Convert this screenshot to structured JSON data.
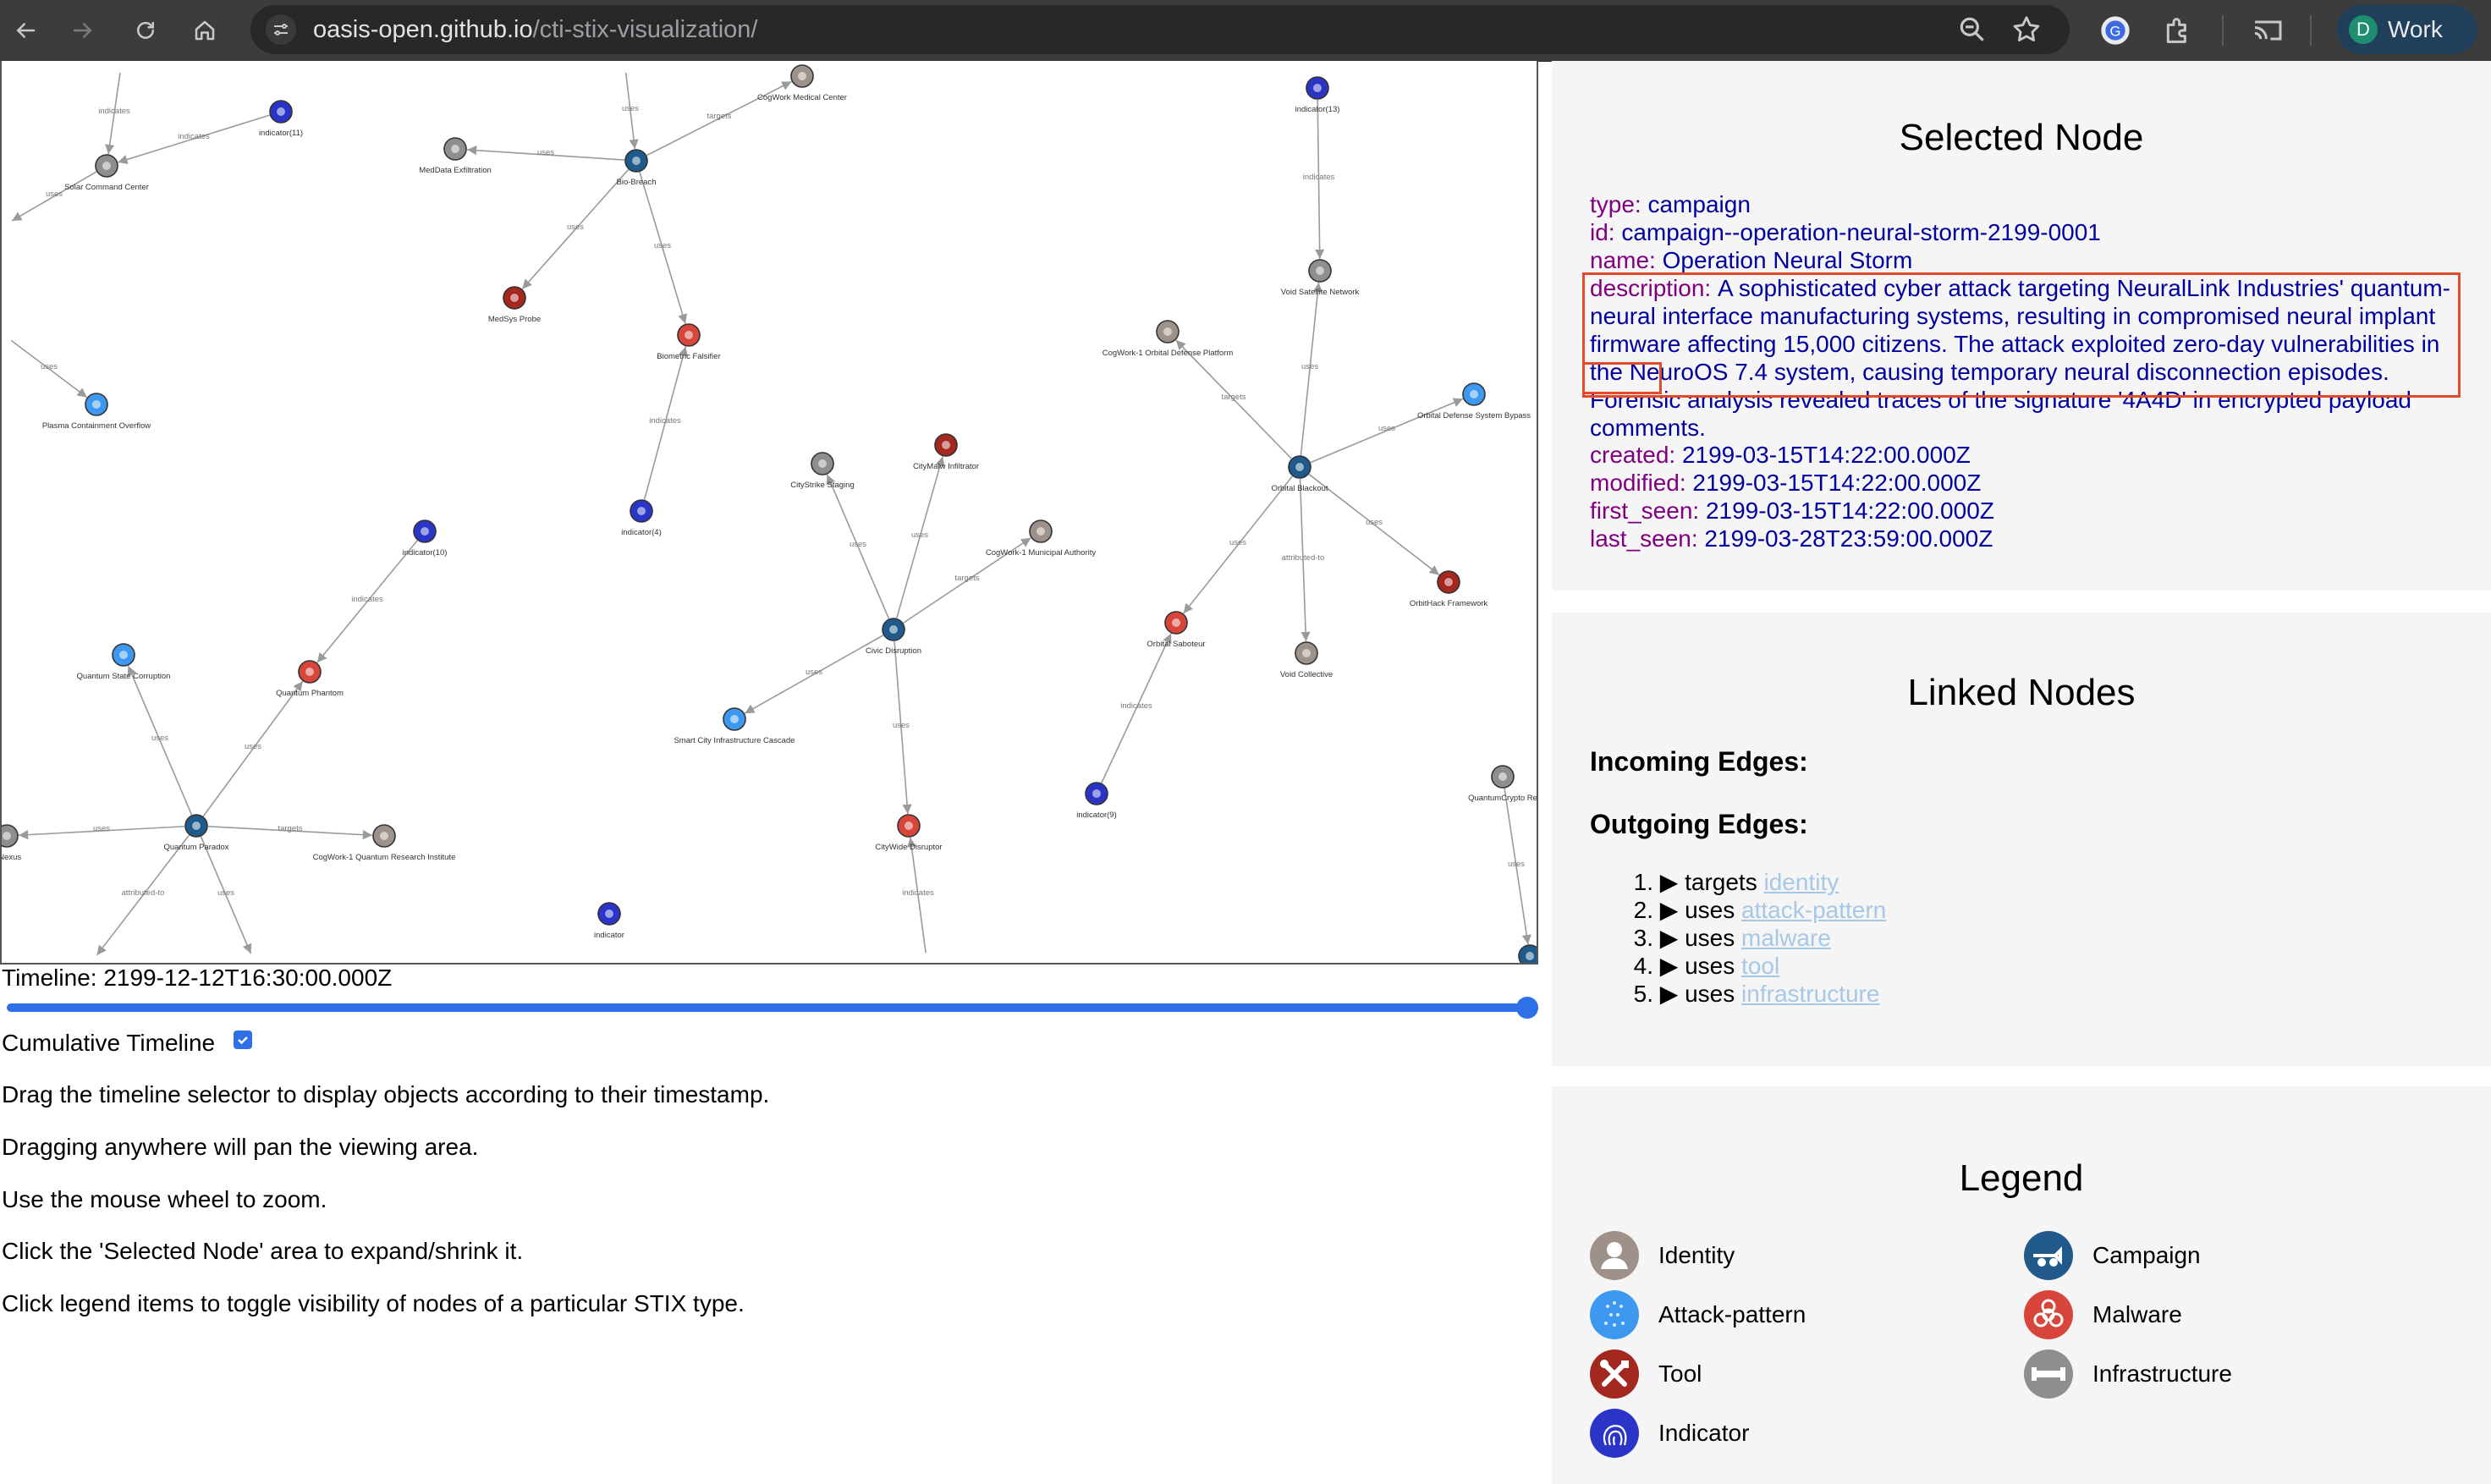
{
  "browser": {
    "url_host": "oasis-open.github.io",
    "url_path": "/cti-stix-visualization/",
    "profile_initial": "D",
    "profile_label": "Work"
  },
  "graph": {
    "edges": [
      {
        "from": "t_indicates_top",
        "to": "solar",
        "label": "indicates"
      },
      {
        "from": "ind11",
        "to": "solar",
        "label": "indicates"
      },
      {
        "from": "solar",
        "to": "t_left_uses",
        "label": "uses"
      },
      {
        "from": "t_left_uses2",
        "to": "plasma",
        "label": "uses"
      },
      {
        "from": "t_top_uses",
        "to": "biobreach",
        "label": "uses"
      },
      {
        "from": "biobreach",
        "to": "cogmed",
        "label": "targets"
      },
      {
        "from": "biobreach",
        "to": "medexf",
        "label": "uses"
      },
      {
        "from": "biobreach",
        "to": "medsys",
        "label": "uses"
      },
      {
        "from": "biobreach",
        "to": "biomet",
        "label": "uses"
      },
      {
        "from": "ind4",
        "to": "biomet",
        "label": "indicates"
      },
      {
        "from": "ind13",
        "to": "voidsat",
        "label": "indicates"
      },
      {
        "from": "orbital",
        "to": "voidsat",
        "label": "uses"
      },
      {
        "from": "orbital",
        "to": "cogorb",
        "label": "targets"
      },
      {
        "from": "orbital",
        "to": "orbdef",
        "label": "uses"
      },
      {
        "from": "orbital",
        "to": "orbhack",
        "label": "uses"
      },
      {
        "from": "orbital",
        "to": "orbsab",
        "label": "uses"
      },
      {
        "from": "orbital",
        "to": "voidcol",
        "label": "attributed-to"
      },
      {
        "from": "ind9",
        "to": "orbsab",
        "label": "indicates"
      },
      {
        "from": "civic",
        "to": "citystrike",
        "label": "uses"
      },
      {
        "from": "civic",
        "to": "citymalw",
        "label": "uses"
      },
      {
        "from": "civic",
        "to": "cogmun",
        "label": "targets"
      },
      {
        "from": "civic",
        "to": "smartcity",
        "label": "uses"
      },
      {
        "from": "civic",
        "to": "citywide",
        "label": "uses"
      },
      {
        "from": "t_bottom_ind",
        "to": "citywide",
        "label": "indicates"
      },
      {
        "from": "ind10",
        "to": "qphantom",
        "label": "indicates"
      },
      {
        "from": "qparadox",
        "to": "qstate",
        "label": "uses"
      },
      {
        "from": "qparadox",
        "to": "qphantom",
        "label": "uses"
      },
      {
        "from": "qparadox",
        "to": "cogqri",
        "label": "targets"
      },
      {
        "from": "qparadox",
        "to": "nexus",
        "label": "uses"
      },
      {
        "from": "qparadox",
        "to": "t_attr",
        "label": "attributed-to"
      },
      {
        "from": "qparadox",
        "to": "t_uses_b",
        "label": "uses"
      },
      {
        "from": "qcrypto",
        "to": "campaign_br",
        "label": "uses"
      }
    ],
    "nodes": [
      {
        "id": "solar",
        "label": "Solar Command Center",
        "type": "infrastructure"
      },
      {
        "id": "ind11",
        "label": "indicator(11)",
        "type": "indicator"
      },
      {
        "id": "plasma",
        "label": "Plasma Containment Overflow",
        "type": "attack-pattern"
      },
      {
        "id": "cogmed",
        "label": "CogWork Medical Center",
        "type": "identity"
      },
      {
        "id": "medexf",
        "label": "MedData Exfiltration",
        "type": "infrastructure"
      },
      {
        "id": "biobreach",
        "label": "Bio-Breach",
        "type": "campaign"
      },
      {
        "id": "medsys",
        "label": "MedSys Probe",
        "type": "tool"
      },
      {
        "id": "biomet",
        "label": "Biometric Falsifier",
        "type": "malware"
      },
      {
        "id": "ind4",
        "label": "indicator(4)",
        "type": "indicator"
      },
      {
        "id": "ind13",
        "label": "indicator(13)",
        "type": "indicator"
      },
      {
        "id": "voidsat",
        "label": "Void Satellite Network",
        "type": "infrastructure"
      },
      {
        "id": "cogorb",
        "label": "CogWork-1 Orbital Defense Platform",
        "type": "identity"
      },
      {
        "id": "orbdef",
        "label": "Orbital Defense System Bypass",
        "type": "attack-pattern"
      },
      {
        "id": "orbital",
        "label": "Orbital Blackout",
        "type": "campaign"
      },
      {
        "id": "orbhack",
        "label": "OrbitHack Framework",
        "type": "tool"
      },
      {
        "id": "orbsab",
        "label": "Orbital Saboteur",
        "type": "malware"
      },
      {
        "id": "voidcol",
        "label": "Void Collective",
        "type": "identity"
      },
      {
        "id": "ind9",
        "label": "indicator(9)",
        "type": "indicator"
      },
      {
        "id": "citystrike",
        "label": "CityStrike Staging",
        "type": "infrastructure"
      },
      {
        "id": "citymalw",
        "label": "CityMalw Infiltrator",
        "type": "tool"
      },
      {
        "id": "cogmun",
        "label": "CogWork-1 Municipal Authority",
        "type": "identity"
      },
      {
        "id": "civic",
        "label": "Civic Disruption",
        "type": "campaign"
      },
      {
        "id": "smartcity",
        "label": "Smart City Infrastructure Cascade",
        "type": "attack-pattern"
      },
      {
        "id": "citywide",
        "label": "CityWide Disruptor",
        "type": "malware"
      },
      {
        "id": "ind10",
        "label": "indicator(10)",
        "type": "indicator"
      },
      {
        "id": "qstate",
        "label": "Quantum State Corruption",
        "type": "attack-pattern"
      },
      {
        "id": "qphantom",
        "label": "Quantum Phantom",
        "type": "malware"
      },
      {
        "id": "qparadox",
        "label": "Quantum Paradox",
        "type": "campaign"
      },
      {
        "id": "cogqri",
        "label": "CogWork-1 Quantum Research Institute",
        "type": "identity"
      },
      {
        "id": "nexus",
        "label": "x Nexus",
        "type": "infrastructure"
      },
      {
        "id": "ind",
        "label": "indicator",
        "type": "indicator"
      },
      {
        "id": "qcrypto",
        "label": "QuantumCrypto Re",
        "type": "infrastructure"
      },
      {
        "id": "campaign_br",
        "label": "",
        "type": "campaign"
      }
    ]
  },
  "timeline": {
    "label": "Timeline: 2199-12-12T16:30:00.000Z",
    "value_fraction": 1.0,
    "cumulative_label": "Cumulative Timeline",
    "cumulative_checked": true
  },
  "help": [
    "Drag the timeline selector to display objects according to their timestamp.",
    "Dragging anywhere will pan the viewing area.",
    "Use the mouse wheel to zoom.",
    "Click the 'Selected Node' area to expand/shrink it.",
    "Click legend items to toggle visibility of nodes of a particular STIX type."
  ],
  "selected_node": {
    "title": "Selected Node",
    "fields": [
      {
        "key": "type:",
        "value": "campaign"
      },
      {
        "key": "id:",
        "value": "campaign--operation-neural-storm-2199-0001"
      },
      {
        "key": "name:",
        "value": "Operation Neural Storm"
      }
    ],
    "description_key": "description:",
    "description_value": "A sophisticated cyber attack targeting NeuralLink Industries' quantum-neural interface manufacturing systems, resulting in compromised neural implant firmware affecting 15,000 citizens. The attack exploited zero-day vulnerabilities in the NeuroOS 7.4 system, causing temporary neural disconnection episodes. Forensic analysis revealed traces of the signature '4A4D' in encrypted payload comments.",
    "fields_after": [
      {
        "key": "created:",
        "value": "2199-03-15T14:22:00.000Z"
      },
      {
        "key": "modified:",
        "value": "2199-03-15T14:22:00.000Z"
      },
      {
        "key": "first_seen:",
        "value": "2199-03-15T14:22:00.000Z"
      },
      {
        "key": "last_seen:",
        "value": "2199-03-28T23:59:00.000Z"
      }
    ]
  },
  "linked_nodes": {
    "title": "Linked Nodes",
    "incoming_label": "Incoming Edges:",
    "outgoing_label": "Outgoing Edges:",
    "outgoing": [
      {
        "num": "1.",
        "rel": "targets",
        "target": "identity"
      },
      {
        "num": "2.",
        "rel": "uses",
        "target": "attack-pattern"
      },
      {
        "num": "3.",
        "rel": "uses",
        "target": "malware"
      },
      {
        "num": "4.",
        "rel": "uses",
        "target": "tool"
      },
      {
        "num": "5.",
        "rel": "uses",
        "target": "infrastructure"
      }
    ]
  },
  "legend": {
    "title": "Legend",
    "items": [
      {
        "label": "Identity",
        "type": "identity"
      },
      {
        "label": "Campaign",
        "type": "campaign"
      },
      {
        "label": "Attack-pattern",
        "type": "attack-pattern"
      },
      {
        "label": "Malware",
        "type": "malware"
      },
      {
        "label": "Tool",
        "type": "tool"
      },
      {
        "label": "Infrastructure",
        "type": "infrastructure"
      },
      {
        "label": "Indicator",
        "type": "indicator"
      }
    ]
  },
  "colors": {
    "identity": "#9e9189",
    "campaign": "#1f5a8a",
    "attack-pattern": "#3d99f0",
    "malware": "#d8453a",
    "tool": "#a3281f",
    "infrastructure": "#8e8e8e",
    "indicator": "#2a35c7",
    "link": "#a6c8e6",
    "highlight": "#e24a2e"
  }
}
